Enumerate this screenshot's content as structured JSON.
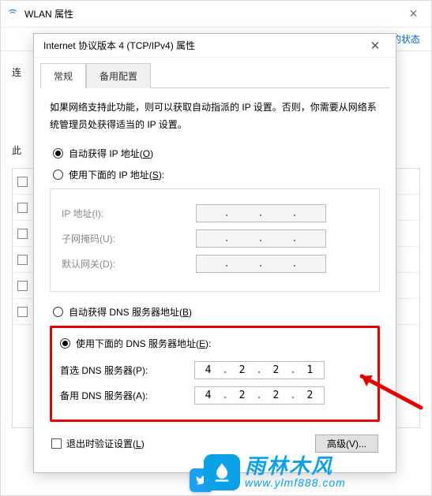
{
  "back": {
    "title": "WLAN 属性",
    "link": "查看此连接的状态",
    "label_conn": "连",
    "label_this": "此"
  },
  "dialog": {
    "title": "Internet 协议版本 4 (TCP/IPv4) 属性",
    "tabs": {
      "general": "常规",
      "alt": "备用配置"
    },
    "hint": "如果网络支持此功能，则可以获取自动指派的 IP 设置。否则，你需要从网络系统管理员处获得适当的 IP 设置。",
    "radio_auto_ip": "自动获得 IP 地址(",
    "radio_auto_ip_u": "O",
    "radio_auto_ip_end": ")",
    "radio_man_ip": "使用下面的 IP 地址(",
    "radio_man_ip_u": "S",
    "radio_man_ip_end": "):",
    "lbl_ip": "IP 地址(I):",
    "lbl_mask": "子网掩码(U):",
    "lbl_gw": "默认网关(D):",
    "radio_auto_dns": "自动获得 DNS 服务器地址(",
    "radio_auto_dns_u": "B",
    "radio_auto_dns_end": ")",
    "radio_man_dns": "使用下面的 DNS 服务器地址(",
    "radio_man_dns_u": "E",
    "radio_man_dns_end": "):",
    "lbl_dns1": "首选 DNS 服务器(P):",
    "lbl_dns2": "备用 DNS 服务器(A):",
    "dns1": {
      "a": "4",
      "b": "2",
      "c": "2",
      "d": "1"
    },
    "dns2": {
      "a": "4",
      "b": "2",
      "c": "2",
      "d": "2"
    },
    "chk_validate": "退出时验证设置(",
    "chk_validate_u": "L",
    "chk_validate_end": ")",
    "btn_adv": "高级(V)..."
  },
  "watermark": {
    "brand": "雨林木风",
    "url": "www.ylmf888.com"
  }
}
